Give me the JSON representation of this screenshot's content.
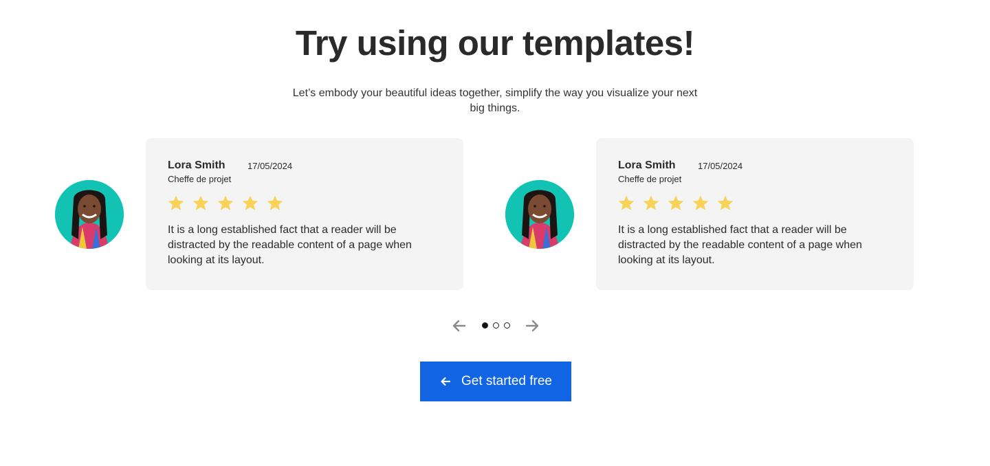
{
  "hero": {
    "title": "Try using our templates!",
    "subtitle": "Let’s embody your beautiful ideas together, simplify the way you visualize your next big things."
  },
  "testimonials": [
    {
      "name": "Lora Smith",
      "role": "Cheffe de projet",
      "date": "17/05/2024",
      "rating": 5,
      "text": "It is a long established fact that a reader will be distracted by the readable content of a page when looking at its layout."
    },
    {
      "name": "Lora Smith",
      "role": "Cheffe de projet",
      "date": "17/05/2024",
      "rating": 5,
      "text": "It is a long established fact that a reader will be distracted by the readable content of a page when looking at its layout."
    }
  ],
  "carousel": {
    "page_count": 3,
    "active_index": 0,
    "prev_icon": "arrow-left-icon",
    "next_icon": "arrow-right-icon"
  },
  "cta": {
    "label": "Get started free",
    "icon": "arrow-left-icon"
  },
  "colors": {
    "accent": "#1164e3",
    "star": "#f9d25a",
    "card_bg": "#f4f4f4",
    "avatar_bg": "#12c3b4"
  }
}
